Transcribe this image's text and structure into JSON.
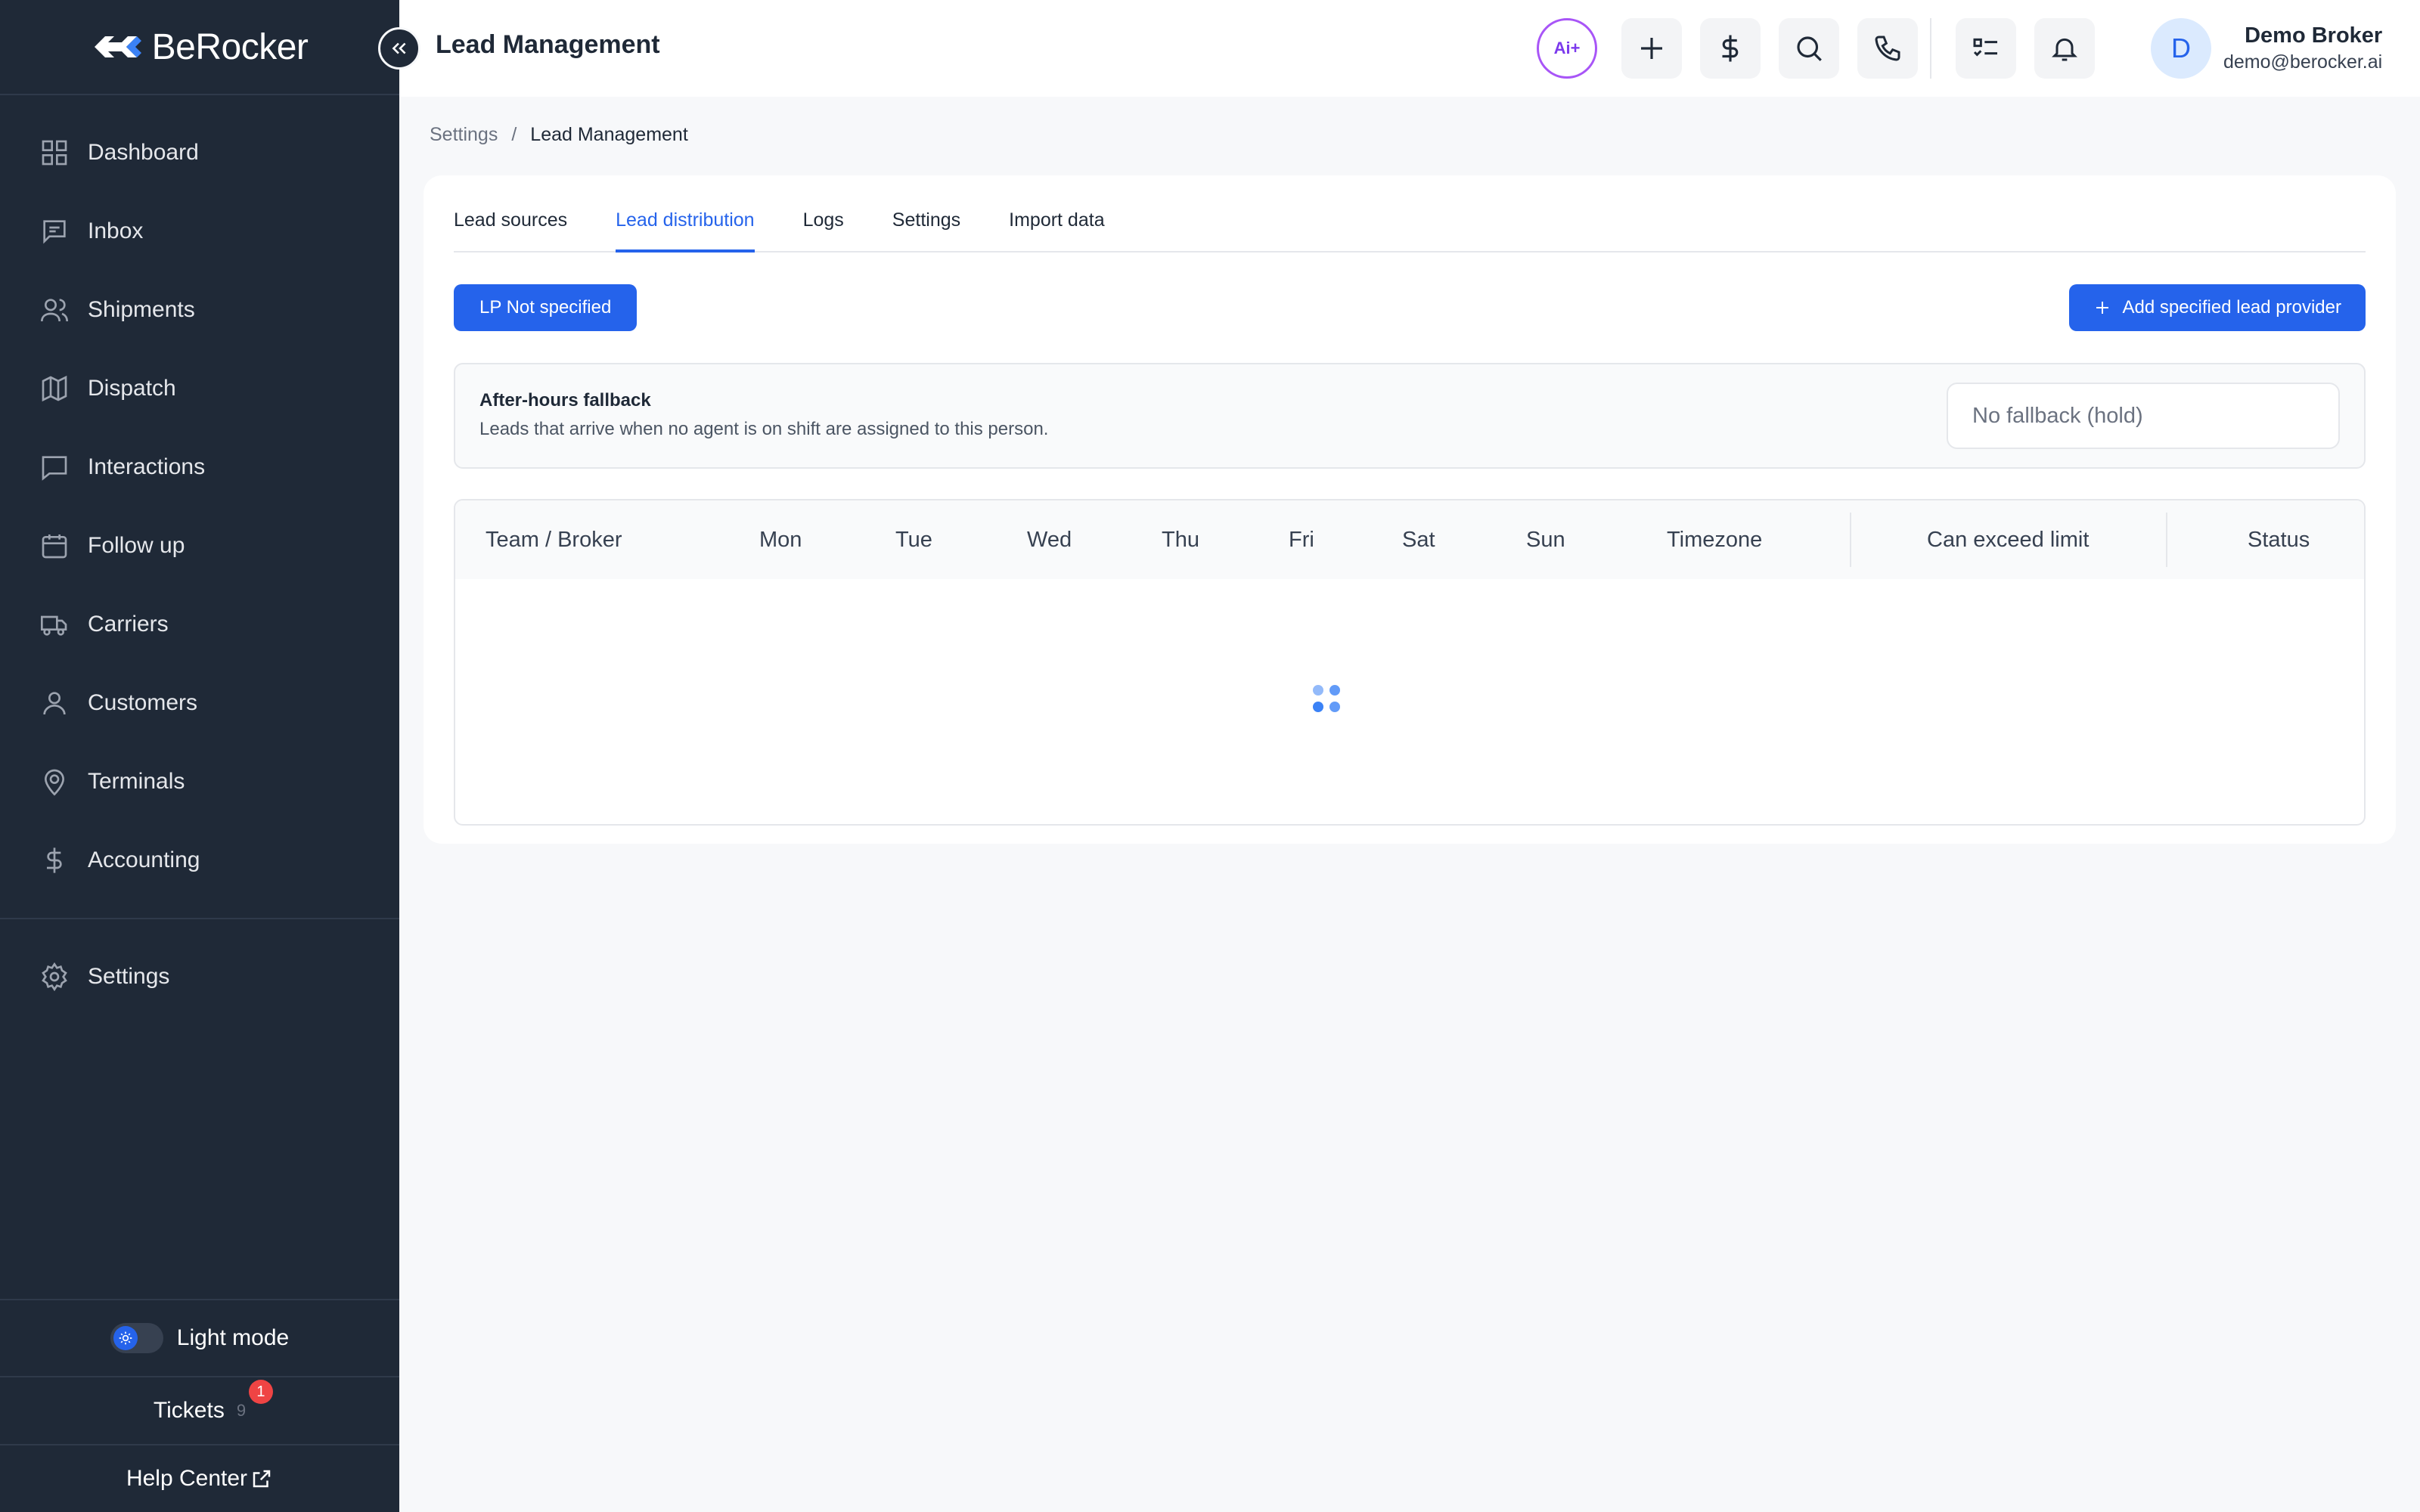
{
  "brand": {
    "name": "BeRocker"
  },
  "sidebar": {
    "items": [
      {
        "label": "Dashboard",
        "icon": "dashboard-icon"
      },
      {
        "label": "Inbox",
        "icon": "inbox-icon"
      },
      {
        "label": "Shipments",
        "icon": "users-icon"
      },
      {
        "label": "Dispatch",
        "icon": "map-icon"
      },
      {
        "label": "Interactions",
        "icon": "chat-icon"
      },
      {
        "label": "Follow up",
        "icon": "calendar-icon"
      },
      {
        "label": "Carriers",
        "icon": "truck-icon"
      },
      {
        "label": "Customers",
        "icon": "user-icon"
      },
      {
        "label": "Terminals",
        "icon": "location-pin-icon"
      },
      {
        "label": "Accounting",
        "icon": "dollar-icon"
      }
    ],
    "settings_label": "Settings",
    "theme_label": "Light mode",
    "tickets_label": "Tickets",
    "tickets_count": "9",
    "tickets_badge": "1",
    "help_label": "Help Center"
  },
  "header": {
    "title": "Lead Management",
    "ai_label": "Ai+",
    "user": {
      "initial": "D",
      "name": "Demo Broker",
      "email": "demo@berocker.ai"
    }
  },
  "breadcrumb": {
    "parent": "Settings",
    "separator": "/",
    "current": "Lead Management"
  },
  "tabs": [
    {
      "label": "Lead sources",
      "active": false
    },
    {
      "label": "Lead distribution",
      "active": true
    },
    {
      "label": "Logs",
      "active": false
    },
    {
      "label": "Settings",
      "active": false
    },
    {
      "label": "Import data",
      "active": false
    }
  ],
  "actions": {
    "lp_filter_label": "LP Not specified",
    "add_provider_label": "Add specified lead provider"
  },
  "fallback": {
    "title": "After-hours fallback",
    "description": "Leads that arrive when no agent is on shift are assigned to this person.",
    "select_value": "No fallback (hold)"
  },
  "table": {
    "columns": [
      "Team / Broker",
      "Mon",
      "Tue",
      "Wed",
      "Thu",
      "Fri",
      "Sat",
      "Sun",
      "Timezone",
      "Can exceed limit",
      "Status"
    ],
    "rows": []
  },
  "colors": {
    "accent": "#2563eb",
    "sidebar_bg": "#1f2937",
    "badge": "#ef4444",
    "ai": "#a855f7"
  }
}
